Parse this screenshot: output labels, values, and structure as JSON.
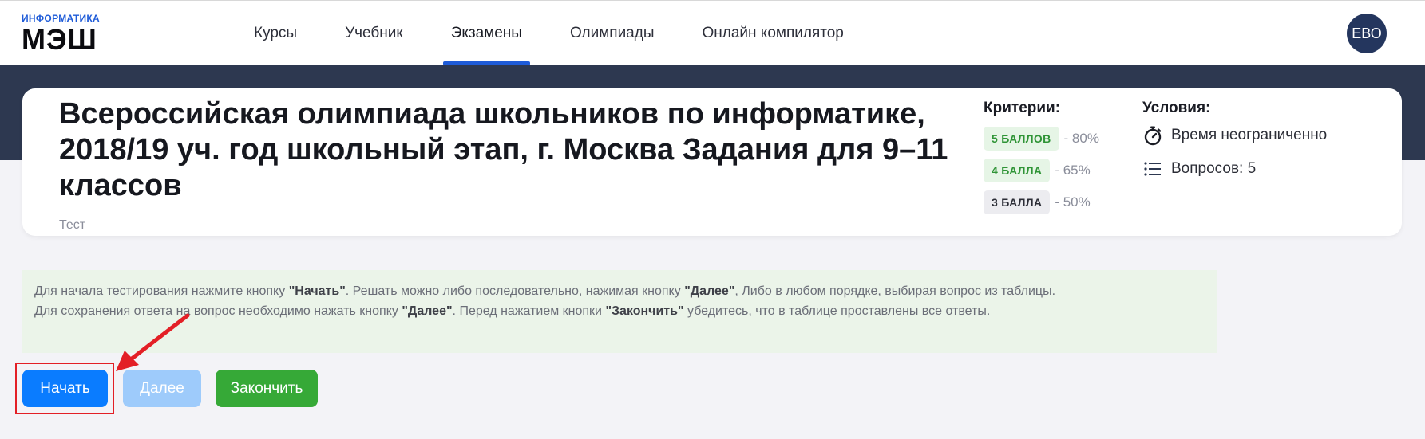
{
  "logo": {
    "small": "ИНФОРМАТИКА",
    "big": "МЭШ"
  },
  "nav": {
    "items": [
      "Курсы",
      "Учебник",
      "Экзамены",
      "Олимпиады",
      "Онлайн компилятор"
    ],
    "active": "Экзамены"
  },
  "user": {
    "initials": "ЕВО"
  },
  "exam": {
    "title": "Всероссийская олимпиада школьников по информатике, 2018/19 уч. год школьный этап, г. Москва Задания для 9–11 классов",
    "type": "Тест"
  },
  "criteria": {
    "heading": "Критерии:",
    "items": [
      {
        "badge": "5 БАЛЛОВ",
        "percent": "- 80%",
        "color": "#2f9436"
      },
      {
        "badge": "4 БАЛЛА",
        "percent": "- 65%",
        "color": "#2f9436"
      },
      {
        "badge": "3 БАЛЛА",
        "percent": "- 50%",
        "color": "#2b2d36"
      }
    ]
  },
  "conditions": {
    "heading": "Условия:",
    "time": "Время неограниченно",
    "time_icon": "stopwatch-icon",
    "questions": "Вопросов: 5",
    "questions_icon": "list-icon"
  },
  "instructions": {
    "l1_a": "Для начала тестирования нажмите кнопку ",
    "l1_b": "\"Начать\"",
    "l1_c": ". Решать можно либо последовательно, нажимая кнопку ",
    "l1_d": "\"Далее\"",
    "l1_e": ", Либо в любом порядке, выбирая вопрос из таблицы.",
    "l2_a": "Для сохранения ответа на вопрос необходимо нажать кнопку ",
    "l2_b": "\"Далее\"",
    "l2_c": ". Перед нажатием кнопки ",
    "l2_d": "\"Закончить\"",
    "l2_e": " убедитесь, что в таблице проставлены все ответы."
  },
  "buttons": {
    "start": "Начать",
    "next": "Далее",
    "finish": "Закончить"
  },
  "colors": {
    "accent": "#1e5bd8",
    "start": "#0a7cff",
    "next_disabled": "#9ecbfb",
    "finish": "#36a937",
    "highlight": "#e31f26"
  }
}
